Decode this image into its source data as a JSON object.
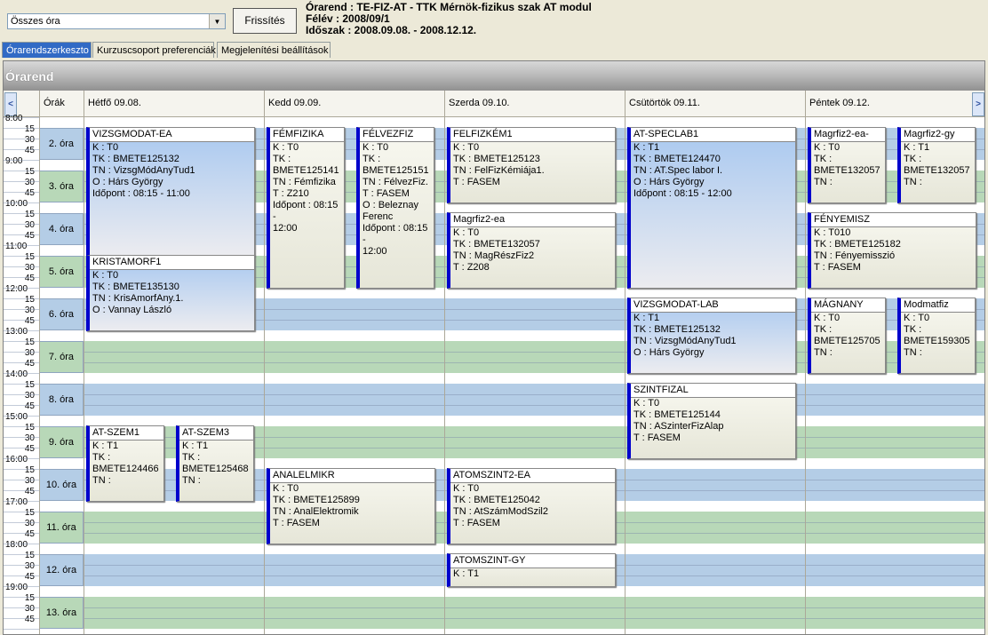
{
  "filter": {
    "value": "Összes óra"
  },
  "refresh_label": "Frissítés",
  "info": {
    "line1": "Órarend : TE-FIZ-AT - TTK Mérnök-fizikus szak AT modul",
    "line2": "Félév : 2008/09/1",
    "line3": "Időszak : 2008.09.08. - 2008.12.12."
  },
  "tabs": [
    "Órarendszerkeszto",
    "Kurzuscsoport preferenciák",
    "Megjelenítési beállítások"
  ],
  "grid_title": "Órarend",
  "header": {
    "prev": "<",
    "next": ">",
    "periods_col": "Órák",
    "days": [
      "Hétfő  09.08.",
      "Kedd  09.09.",
      "Szerda  09.10.",
      "Csütörtök  09.11.",
      "Péntek  09.12."
    ]
  },
  "time_rows": [
    "8:00",
    "15",
    "30",
    "45",
    "9:00",
    "15",
    "30",
    "45",
    "10:00",
    "15",
    "30",
    "45",
    "11:00",
    "15",
    "30",
    "45",
    "12:00",
    "15",
    "30",
    "45",
    "13:00",
    "15",
    "30",
    "45",
    "14:00",
    "15",
    "30",
    "45",
    "15:00",
    "15",
    "30",
    "45",
    "16:00",
    "15",
    "30",
    "45",
    "17:00",
    "15",
    "30",
    "45",
    "18:00",
    "15",
    "30",
    "45",
    "19:00",
    "15",
    "30",
    "45"
  ],
  "periods": [
    "2. óra",
    "3. óra",
    "4. óra",
    "5. óra",
    "6. óra",
    "7. óra",
    "8. óra",
    "9. óra",
    "10. óra",
    "11. óra",
    "12. óra",
    "13. óra"
  ],
  "events": [
    {
      "day": 0,
      "col": 0,
      "span": 1,
      "start": 1,
      "len": 12,
      "style": "blue",
      "title": "VIZSGMODAT-EA",
      "lines": [
        "K : T0",
        "TK : BMETE125132",
        "TN : VizsgMódAnyTud1",
        "O : Hárs György",
        "Időpont : 08:15 - 11:00"
      ]
    },
    {
      "day": 0,
      "col": 0,
      "span": 1,
      "start": 13,
      "len": 7,
      "style": "blue",
      "title": "KRISTAMORF1",
      "lines": [
        "K : T0",
        "TK : BMETE135130",
        "TN : KrisAmorfAny.1.",
        "O : Vannay László"
      ]
    },
    {
      "day": 0,
      "col": 0,
      "span": 2,
      "start": 29,
      "len": 7,
      "style": "",
      "title": "AT-SZEM1",
      "lines": [
        "K : T1",
        "TK :",
        "BMETE124466",
        "TN :"
      ]
    },
    {
      "day": 0,
      "col": 1,
      "span": 2,
      "start": 29,
      "len": 7,
      "style": "",
      "title": "AT-SZEM3",
      "lines": [
        "K : T1",
        "TK :",
        "BMETE125468",
        "TN :"
      ]
    },
    {
      "day": 1,
      "col": 0,
      "span": 2,
      "start": 1,
      "len": 15,
      "style": "",
      "title": "FÉMFIZIKA",
      "lines": [
        "K : T0",
        "TK :",
        "BMETE125141",
        "TN : Fémfizika",
        "T : Z210",
        "Időpont : 08:15 -",
        "12:00"
      ]
    },
    {
      "day": 1,
      "col": 1,
      "span": 2,
      "start": 1,
      "len": 15,
      "style": "",
      "title": "FÉLVEZFIZ",
      "lines": [
        "K : T0",
        "TK :",
        "BMETE125151",
        "TN : FélvezFiz.",
        "T : FASEM",
        "O : Beleznay",
        "Ferenc",
        "Időpont : 08:15 -",
        "12:00"
      ]
    },
    {
      "day": 1,
      "col": 0,
      "span": 1,
      "start": 33,
      "len": 7,
      "style": "",
      "title": "ANALELMIKR",
      "lines": [
        "K : T0",
        "TK : BMETE125899",
        "TN : AnalElektromik",
        "T : FASEM"
      ]
    },
    {
      "day": 2,
      "col": 0,
      "span": 1,
      "start": 1,
      "len": 7,
      "style": "",
      "title": "FELFIZKÉM1",
      "lines": [
        "K : T0",
        "TK : BMETE125123",
        "TN : FelFizKémiája1.",
        "T : FASEM"
      ]
    },
    {
      "day": 2,
      "col": 0,
      "span": 1,
      "start": 9,
      "len": 7,
      "style": "",
      "title": "Magrfiz2-ea",
      "lines": [
        "K : T0",
        "TK : BMETE132057",
        "TN : MagRészFiz2",
        "T : Z208"
      ]
    },
    {
      "day": 2,
      "col": 0,
      "span": 1,
      "start": 33,
      "len": 7,
      "style": "",
      "title": "ATOMSZINT2-EA",
      "lines": [
        "K : T0",
        "TK : BMETE125042",
        "TN : AtSzámModSzil2",
        "T : FASEM"
      ]
    },
    {
      "day": 2,
      "col": 0,
      "span": 1,
      "start": 41,
      "len": 3,
      "style": "",
      "title": "ATOMSZINT-GY",
      "lines": [
        "K : T1"
      ]
    },
    {
      "day": 3,
      "col": 0,
      "span": 1,
      "start": 1,
      "len": 15,
      "style": "blue",
      "title": "AT-SPECLAB1",
      "lines": [
        "K : T1",
        "TK : BMETE124470",
        "TN : AT.Spec labor I.",
        "O : Hárs György",
        "Időpont : 08:15 - 12:00"
      ]
    },
    {
      "day": 3,
      "col": 0,
      "span": 1,
      "start": 17,
      "len": 7,
      "style": "blue",
      "title": "VIZSGMODAT-LAB",
      "lines": [
        "K : T1",
        "TK : BMETE125132",
        "TN : VizsgMódAnyTud1",
        "O : Hárs György"
      ]
    },
    {
      "day": 3,
      "col": 0,
      "span": 1,
      "start": 25,
      "len": 7,
      "style": "",
      "title": "SZINTFIZAL",
      "lines": [
        "K : T0",
        "TK : BMETE125144",
        "TN : ASzinterFizAlap",
        "T : FASEM"
      ]
    },
    {
      "day": 4,
      "col": 0,
      "span": 2,
      "start": 1,
      "len": 7,
      "style": "",
      "title": "Magrfiz2-ea-",
      "lines": [
        "K : T0",
        "TK :",
        "BMETE132057",
        "TN :"
      ]
    },
    {
      "day": 4,
      "col": 1,
      "span": 2,
      "start": 1,
      "len": 7,
      "style": "",
      "title": "Magrfiz2-gy",
      "lines": [
        "K : T1",
        "TK :",
        "BMETE132057",
        "TN :"
      ]
    },
    {
      "day": 4,
      "col": 0,
      "span": 1,
      "start": 9,
      "len": 7,
      "style": "",
      "title": "FÉNYEMISZ",
      "lines": [
        "K : T010",
        "TK : BMETE125182",
        "TN : Fényemisszió",
        "T : FASEM"
      ]
    },
    {
      "day": 4,
      "col": 0,
      "span": 2,
      "start": 17,
      "len": 7,
      "style": "",
      "title": "MÁGNANY",
      "lines": [
        "K : T0",
        "TK :",
        "BMETE125705",
        "TN :"
      ]
    },
    {
      "day": 4,
      "col": 1,
      "span": 2,
      "start": 17,
      "len": 7,
      "style": "",
      "title": "Modmatfiz",
      "lines": [
        "K : T0",
        "TK :",
        "BMETE159305",
        "TN :"
      ]
    }
  ],
  "colors": {
    "band_blue": "#b4cde6",
    "band_green": "#b8d8b8",
    "event_bar": "#0000cc",
    "tab_active": "#316ac5"
  }
}
